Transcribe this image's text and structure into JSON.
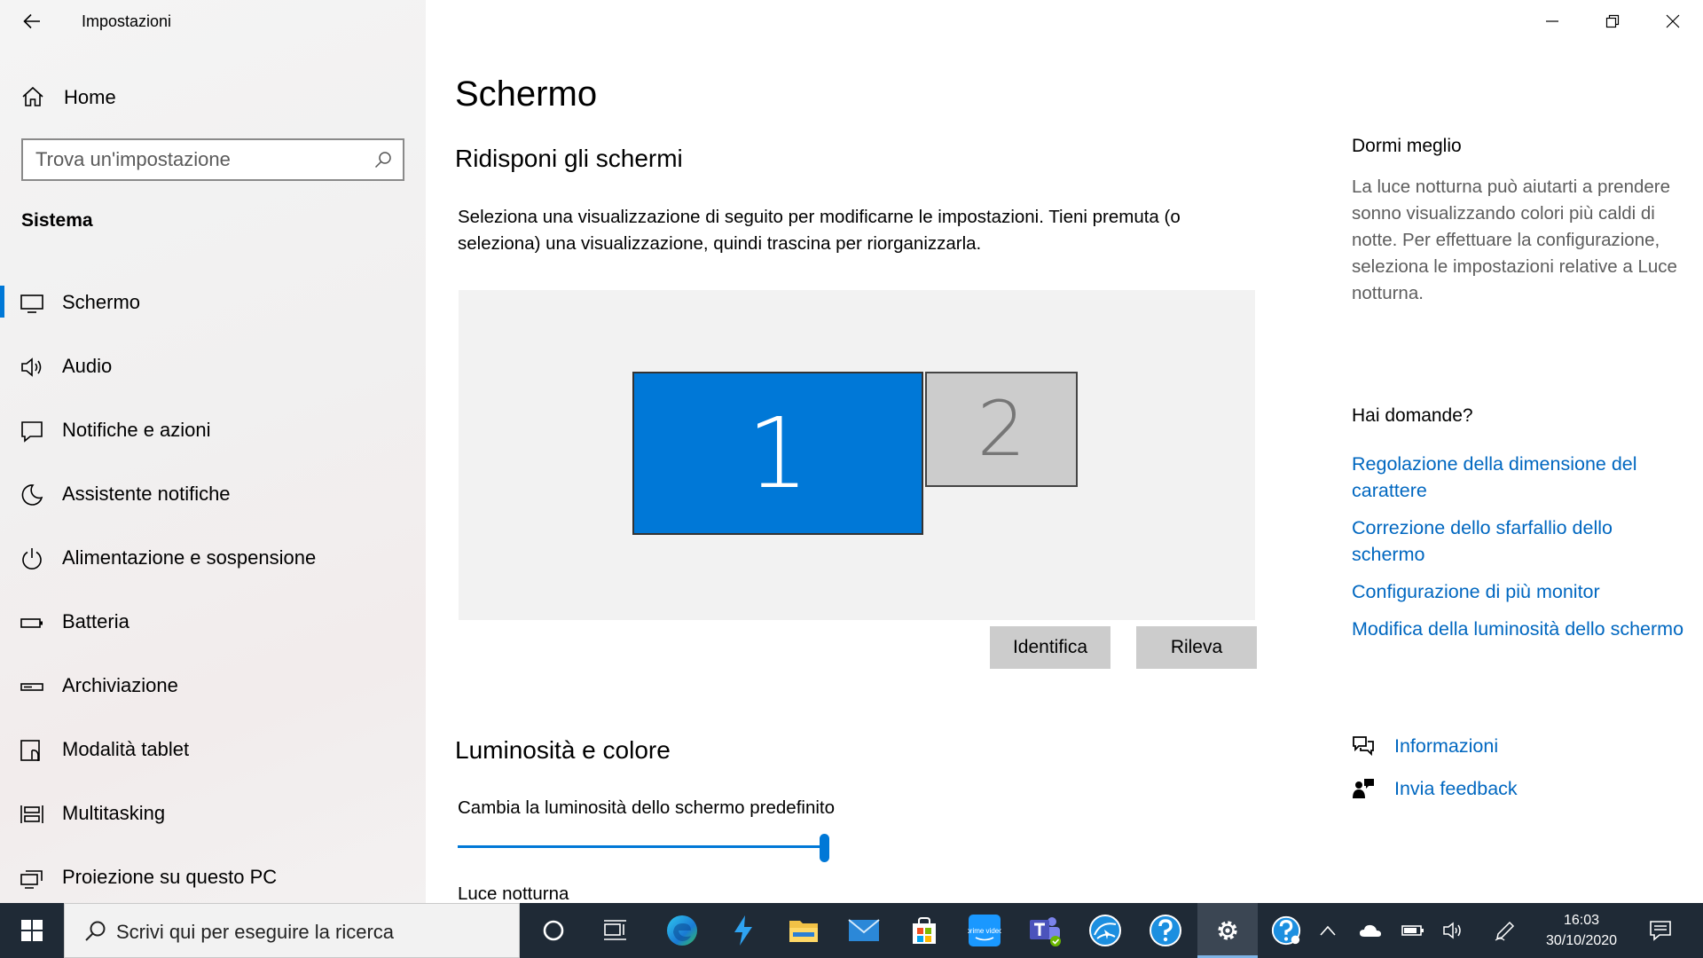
{
  "window": {
    "app_title": "Impostazioni"
  },
  "sidebar": {
    "home_label": "Home",
    "search_placeholder": "Trova un'impostazione",
    "section_label": "Sistema",
    "items": [
      {
        "label": "Schermo",
        "icon": "monitor-icon",
        "selected": true
      },
      {
        "label": "Audio",
        "icon": "speaker-icon",
        "selected": false
      },
      {
        "label": "Notifiche e azioni",
        "icon": "message-icon",
        "selected": false
      },
      {
        "label": "Assistente notifiche",
        "icon": "moon-icon",
        "selected": false
      },
      {
        "label": "Alimentazione e sospensione",
        "icon": "power-icon",
        "selected": false
      },
      {
        "label": "Batteria",
        "icon": "battery-icon",
        "selected": false
      },
      {
        "label": "Archiviazione",
        "icon": "storage-icon",
        "selected": false
      },
      {
        "label": "Modalità tablet",
        "icon": "tablet-mode-icon",
        "selected": false
      },
      {
        "label": "Multitasking",
        "icon": "multitasking-icon",
        "selected": false
      },
      {
        "label": "Proiezione su questo PC",
        "icon": "projection-icon",
        "selected": false
      }
    ]
  },
  "main": {
    "page_title": "Schermo",
    "arrange_title": "Ridisponi gli schermi",
    "arrange_desc": "Seleziona una visualizzazione di seguito per modificarne le impostazioni. Tieni premuta (o seleziona) una visualizzazione, quindi trascina per riorganizzarla.",
    "monitors": [
      {
        "number": "1",
        "selected": true
      },
      {
        "number": "2",
        "selected": false
      }
    ],
    "identify_button": "Identifica",
    "detect_button": "Rileva",
    "brightness_title": "Luminosità e colore",
    "brightness_label": "Cambia la luminosità dello schermo predefinito",
    "brightness_level": 1.0,
    "night_light_label": "Luce notturna"
  },
  "aside": {
    "sleep_title": "Dormi meglio",
    "sleep_text": "La luce notturna può aiutarti a prendere sonno visualizzando colori più caldi di notte. Per effettuare la configurazione, seleziona le impostazioni relative a Luce notturna.",
    "questions_title": "Hai domande?",
    "links": [
      "Regolazione della dimensione del carattere",
      "Correzione dello sfarfallio dello schermo",
      "Configurazione di più monitor",
      "Modifica della luminosità dello schermo"
    ],
    "help_label": "Informazioni",
    "feedback_label": "Invia feedback"
  },
  "taskbar": {
    "search_placeholder": "Scrivi qui per eseguire la ricerca",
    "apps": [
      "cortana-icon",
      "task-view-icon",
      "edge-icon",
      "app-bolt-icon",
      "file-explorer-icon",
      "mail-icon",
      "store-icon",
      "prime-video-icon",
      "teams-icon",
      "browser-globe-icon",
      "help-icon",
      "settings-icon"
    ],
    "prime_video_text": "prime video",
    "time": "16:03",
    "date": "30/10/2020"
  },
  "colors": {
    "accent": "#0078d7",
    "link": "#0067c0",
    "taskbar": "#1f2a36"
  }
}
